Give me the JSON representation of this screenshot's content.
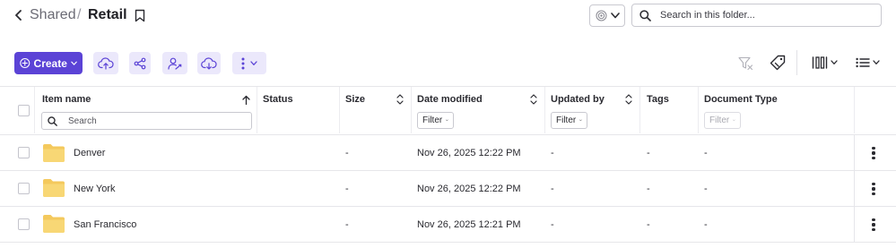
{
  "header": {
    "back_icon": "chevron-left-icon",
    "breadcrumb_parent": "Shared",
    "breadcrumb_separator": "/",
    "breadcrumb_current": "Retail",
    "bookmark_icon": "bookmark-icon",
    "scope_icon": "target-icon",
    "search_placeholder": "Search in this folder..."
  },
  "toolbar": {
    "create_label": "Create",
    "accent_color": "#5b43d6",
    "secondary_bg": "#ebe8fb",
    "buttons": [
      "upload-icon",
      "share-icon",
      "assign-user-icon",
      "download-icon",
      "more-icon"
    ],
    "right_icons": [
      "filter-clear-icon",
      "tag-icon",
      "columns-icon",
      "list-view-icon"
    ]
  },
  "table": {
    "columns": {
      "name": "Item name",
      "status": "Status",
      "size": "Size",
      "date_modified": "Date modified",
      "updated_by": "Updated by",
      "tags": "Tags",
      "document_type": "Document Type"
    },
    "name_search_placeholder": "Search",
    "filter_label": "Filter",
    "rows": [
      {
        "name": "Denver",
        "size": "-",
        "date_modified": "Nov 26, 2025 12:22 PM",
        "updated_by": "-",
        "tags": "-",
        "document_type": "-"
      },
      {
        "name": "New York",
        "size": "-",
        "date_modified": "Nov 26, 2025 12:22 PM",
        "updated_by": "-",
        "tags": "-",
        "document_type": "-"
      },
      {
        "name": "San Francisco",
        "size": "-",
        "date_modified": "Nov 26, 2025 12:21 PM",
        "updated_by": "-",
        "tags": "-",
        "document_type": "-"
      }
    ]
  }
}
